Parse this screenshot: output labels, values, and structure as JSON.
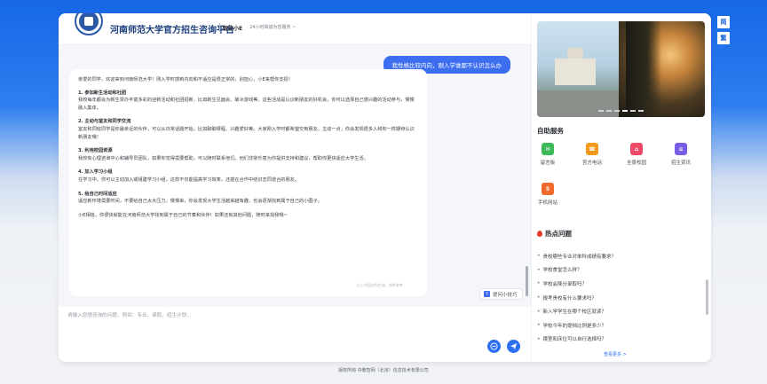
{
  "side_buttons": [
    "简",
    "繁"
  ],
  "header": {
    "site_title": "河南师范大学官方招生咨询平台",
    "brand": "智能小E",
    "slogan": "· 24小时竭诚为您服务 ~"
  },
  "conversation": {
    "user_message": "我性格比较内向，刚入学谁都不认识怎么办",
    "bot_reply": {
      "intro": "亲爱的同学，欢迎来到河南师范大学！刚入学时感到内向和不适应是很正常的，别担心，小E来帮你支招！",
      "sections": [
        {
          "heading": "1. 参加新生活动和社团",
          "body": "我校每年都会为新生举办丰富多彩的迎新活动和社团招新，比如新生见面会、破冰游戏等。这些活动是认识新朋友的好机会，你可以选择自己感兴趣的活动参与，慢慢融入集体。"
        },
        {
          "heading": "2. 主动与室友和同学交流",
          "body": "室友和同班同学是你最亲近的伙伴，可以从日常话题开始，比如聊聊课程、兴趣爱好等。大家刚入学时都希望交到朋友，主动一点，你会发现很多人和你一样期待认识新朋友哦！"
        },
        {
          "heading": "3. 利用校园资源",
          "body": "我校有心理咨询中心和辅导员团队，如果你觉得需要帮助，可以随时联系他们。他们非常乐意为你提供支持和建议，帮助你更快适应大学生活。"
        },
        {
          "heading": "4. 加入学习小组",
          "body": "在学习中，你可以主动加入或组建学习小组，这样不仅能提高学习效率，还能在合作中结识志同道合的朋友。"
        },
        {
          "heading": "5. 给自己时间适应",
          "body": "适应新环境需要时间，不要给自己太大压力。慢慢来，你会发现大学生活越来越有趣，也会逐渐找到属于自己的小圈子。"
        }
      ],
      "outro": "小E相信，你很快就能在河南师范大学找到属于自己的节奏和伙伴！如果还有其他问题，随时来找我哦~"
    },
    "cutoff_text": "以上内容由AI生成，仅供参考",
    "skills_button": "提问小技巧"
  },
  "input": {
    "placeholder": "请输入您想咨询的问题，例如：专业、录取、招生计划...",
    "value": ""
  },
  "services": {
    "title": "自助服务",
    "items": [
      {
        "label": "留言板",
        "color": "#3cba5b",
        "icon": "message-board-icon"
      },
      {
        "label": "官方电话",
        "color": "#f39a1c",
        "icon": "phone-icon"
      },
      {
        "label": "全景校园",
        "color": "#ef4b68",
        "icon": "campus-icon"
      },
      {
        "label": "招生资讯",
        "color": "#7b5ce6",
        "icon": "news-icon"
      },
      {
        "label": "手机网站",
        "color": "#f06a2c",
        "icon": "html5-icon"
      }
    ]
  },
  "faq": {
    "title": "热点问题",
    "items": [
      "贵校哪些专业对单科成绩有要求？",
      "学校食堂怎么样？",
      "学校会降分录取吗？",
      "报考贵校有什么要求吗？",
      "新入学学生在哪个校区就读？",
      "学校今年的提档比例是多少？",
      "寝室和床位可以自行选择吗？"
    ],
    "see_more": "查看更多 >"
  },
  "footer": "版权所有  中教智网（北京）信息技术有限公司"
}
